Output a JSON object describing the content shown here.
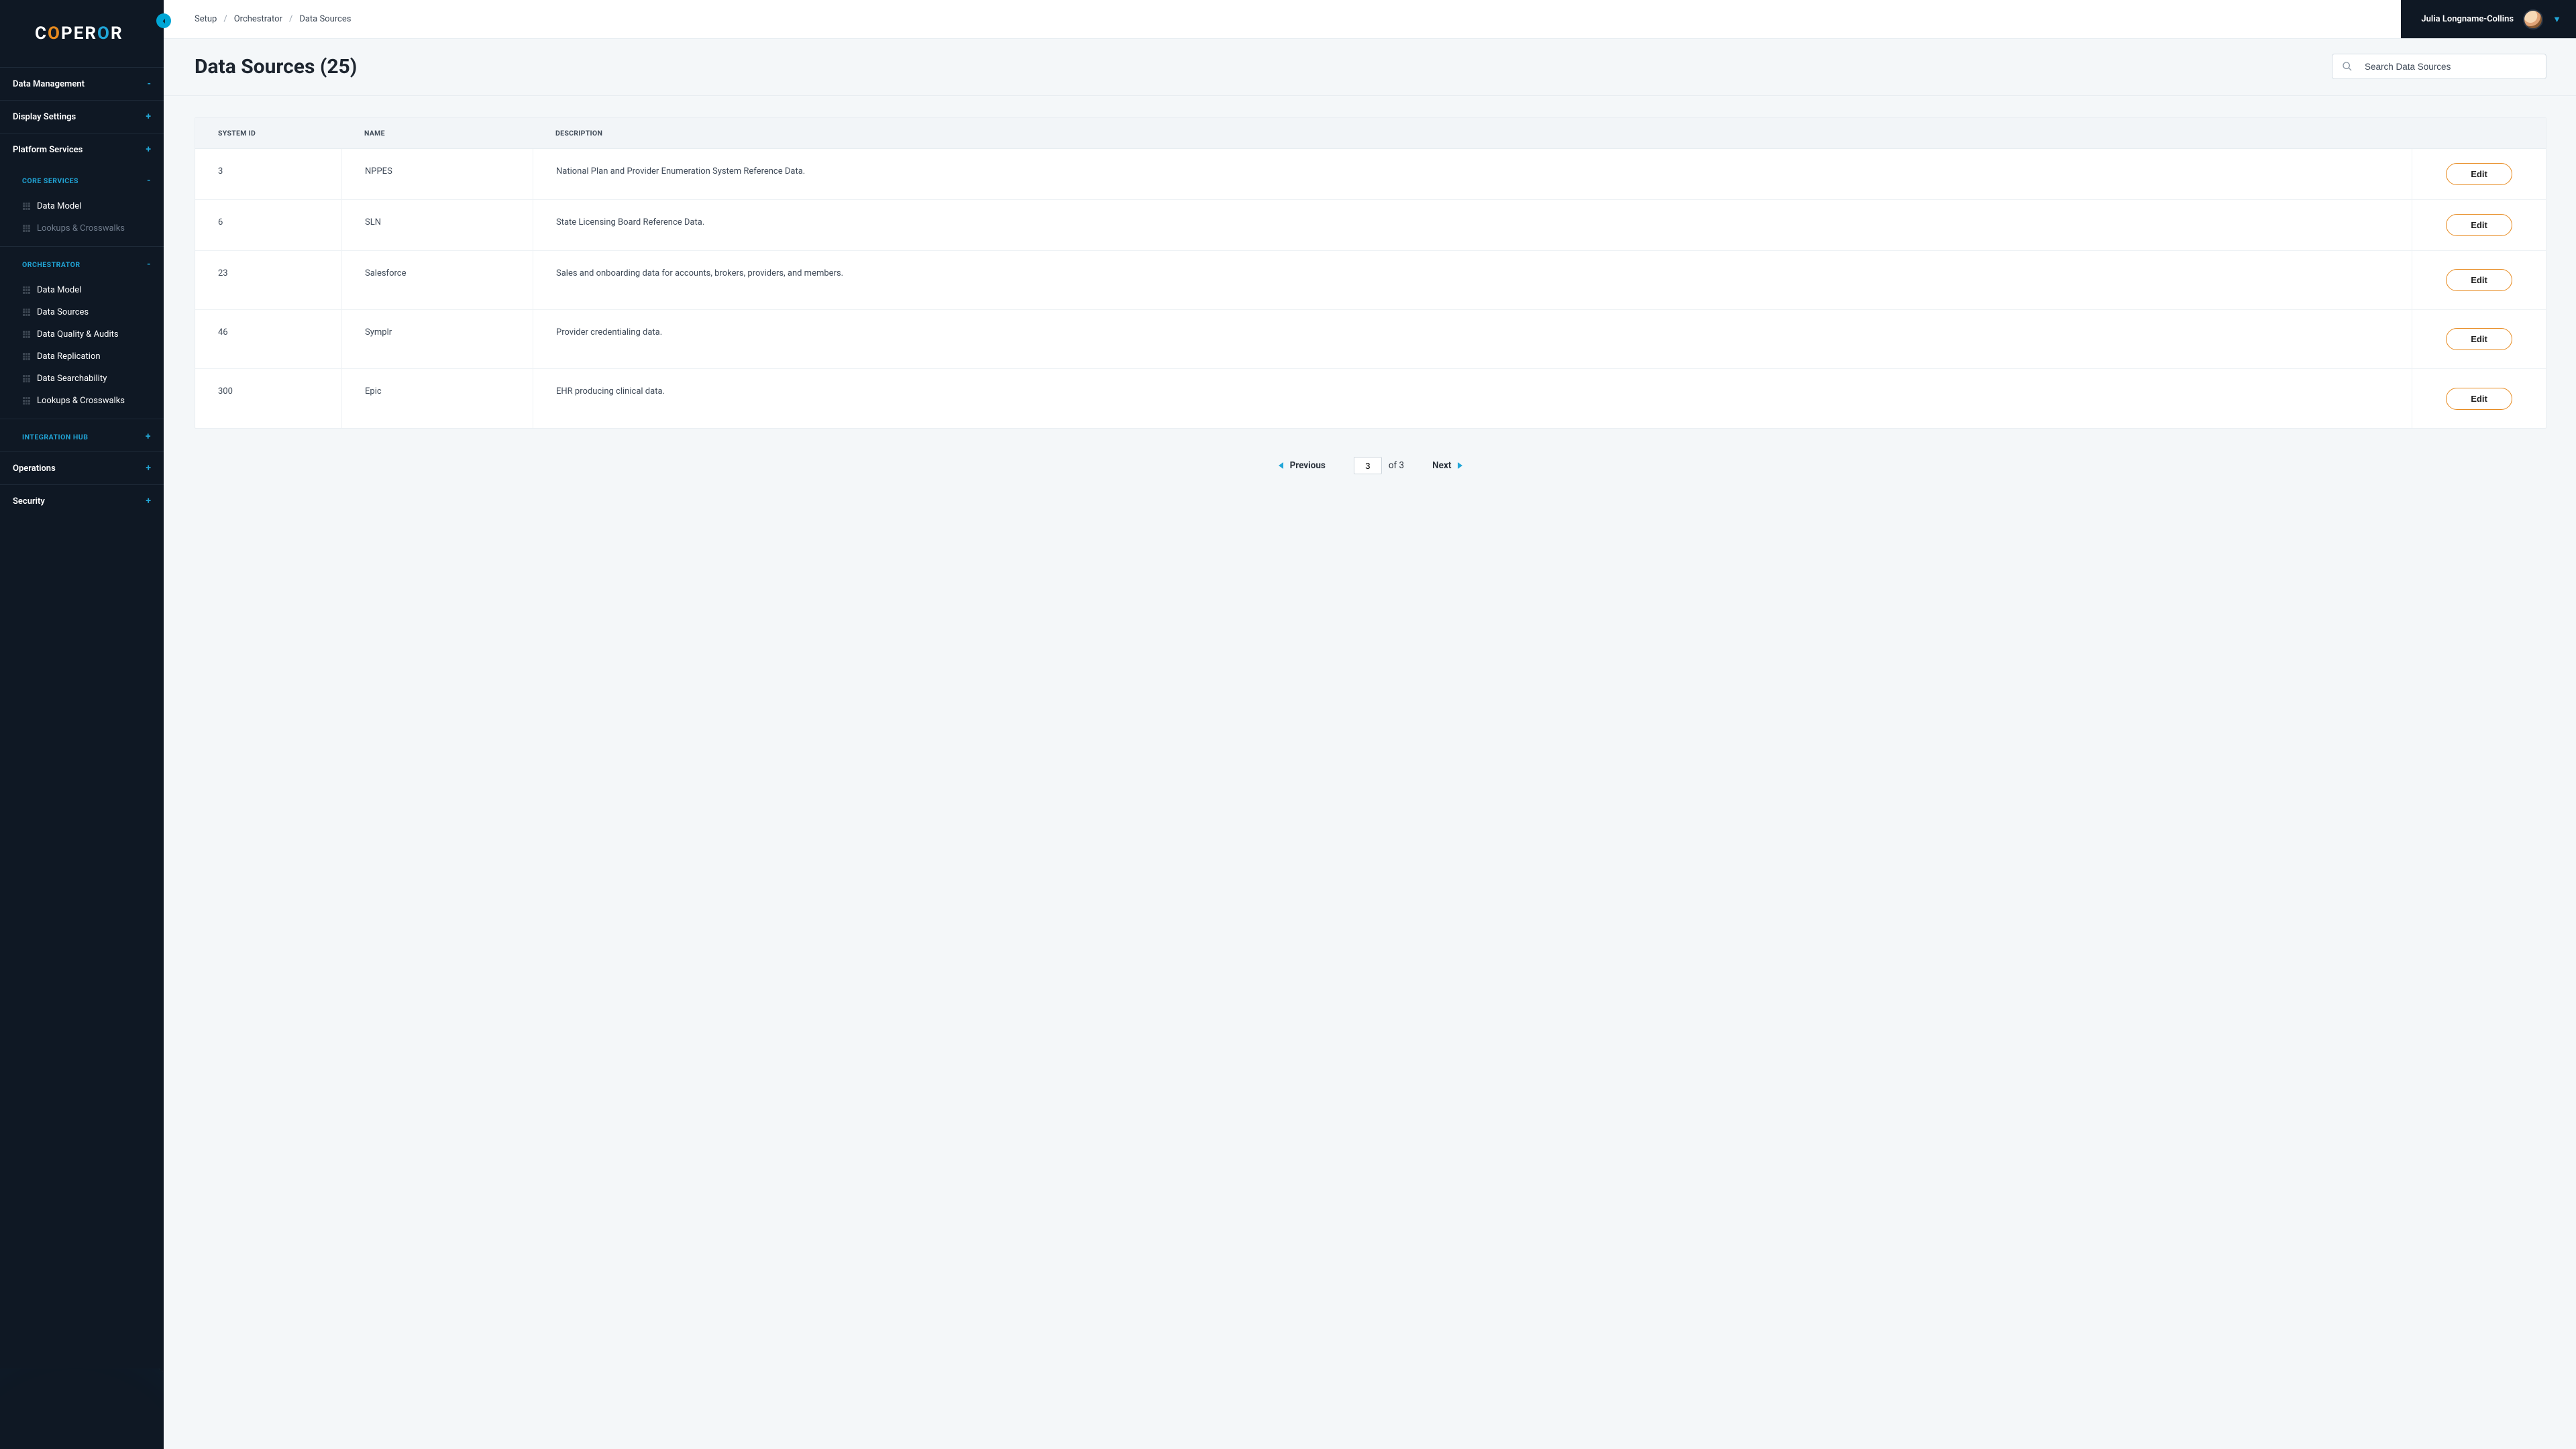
{
  "brand": {
    "name": "COPEROR"
  },
  "user": {
    "display_name": "Julia Longname-Collins"
  },
  "breadcrumbs": {
    "a": "Setup",
    "b": "Orchestrator",
    "c": "Data Sources"
  },
  "page": {
    "title": "Data Sources (25)"
  },
  "search": {
    "placeholder": "Search Data Sources"
  },
  "sidebar": {
    "groups": {
      "data_management": {
        "label": "Data Management",
        "expander": "-"
      },
      "display_settings": {
        "label": "Display Settings",
        "expander": "+"
      },
      "platform_services": {
        "label": "Platform Services",
        "expander": "+"
      },
      "operations": {
        "label": "Operations",
        "expander": "+"
      },
      "security": {
        "label": "Security",
        "expander": "+"
      }
    },
    "core_services": {
      "label": "CORE SERVICES",
      "expander": "-",
      "items": [
        {
          "label": "Data Model"
        },
        {
          "label": "Lookups & Crosswalks"
        }
      ]
    },
    "orchestrator": {
      "label": "ORCHESTRATOR",
      "expander": "-",
      "items": [
        {
          "label": "Data Model"
        },
        {
          "label": "Data Sources"
        },
        {
          "label": "Data Quality & Audits"
        },
        {
          "label": "Data Replication"
        },
        {
          "label": "Data Searchability"
        },
        {
          "label": "Lookups & Crosswalks"
        }
      ]
    },
    "integration_hub": {
      "label": "INTEGRATION HUB",
      "expander": "+"
    }
  },
  "table": {
    "headers": {
      "system_id": "SYSTEM ID",
      "name": "NAME",
      "description": "DESCRIPTION"
    },
    "edit_label": "Edit",
    "rows": [
      {
        "id": "3",
        "name": "NPPES",
        "desc": "National Plan and Provider Enumeration System Reference Data."
      },
      {
        "id": "6",
        "name": "SLN",
        "desc": "State Licensing Board Reference Data."
      },
      {
        "id": "23",
        "name": "Salesforce",
        "desc": "Sales and onboarding data for accounts, brokers, providers, and members."
      },
      {
        "id": "46",
        "name": "Symplr",
        "desc": "Provider credentialing data."
      },
      {
        "id": "300",
        "name": "Epic",
        "desc": "EHR producing clinical data."
      }
    ]
  },
  "pagination": {
    "prev": "Previous",
    "next": "Next",
    "page": "3",
    "of_label": "of 3"
  }
}
